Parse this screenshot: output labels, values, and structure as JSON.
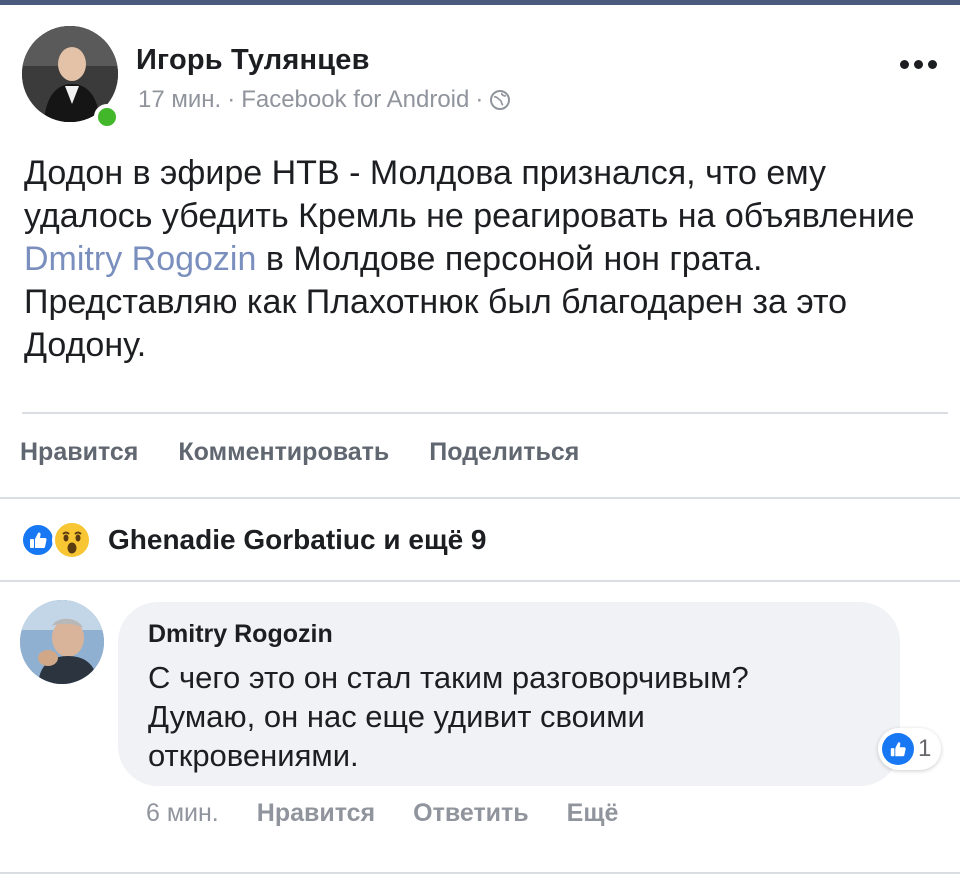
{
  "post": {
    "author": "Игорь Тулянцев",
    "time": "17 мин.",
    "separator": "·",
    "source": "Facebook for Android",
    "privacy_icon": "globe-icon",
    "more_icon": "more-dots-icon",
    "text_before": "Додон в эфире НТВ - Молдова признался, что ему удалось убедить Кремль не реагировать на объявление ",
    "mention": "Dmitry Rogozin",
    "text_after": " в Молдове персоной нон грата. Представляю как Плахотнюк был благодарен за это Додону."
  },
  "actions": {
    "like": "Нравится",
    "comment": "Комментировать",
    "share": "Поделиться"
  },
  "reactions": {
    "icons": [
      "like-icon",
      "wow-icon"
    ],
    "summary": "Ghenadie Gorbatiuc и ещё 9"
  },
  "comment": {
    "author": "Dmitry Rogozin",
    "text": "С чего это он стал таким разговорчивым? Думаю, он нас еще удивит своими откровениями.",
    "like_count": "1",
    "time": "6 мин.",
    "like_action": "Нравится",
    "reply_action": "Ответить",
    "more_action": "Ещё"
  },
  "colors": {
    "accent_blue": "#1877f2",
    "mention": "#7a8fbd",
    "online": "#42b72a",
    "muted_text": "#90949c",
    "header_bar": "#4a5a7c"
  }
}
